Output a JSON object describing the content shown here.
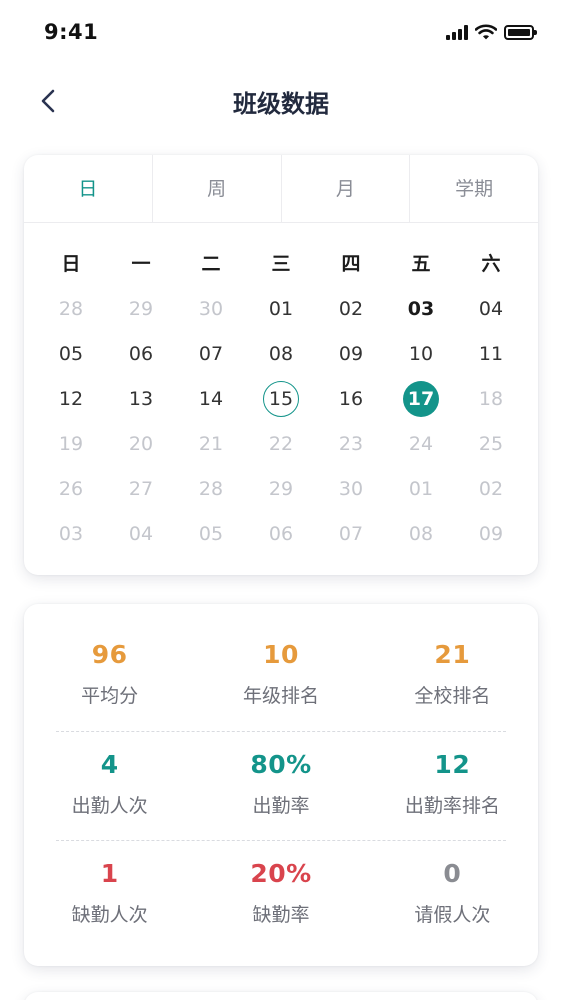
{
  "status_bar": {
    "time": "9:41"
  },
  "header": {
    "title": "班级数据"
  },
  "tabs": [
    {
      "label": "日",
      "active": true
    },
    {
      "label": "周",
      "active": false
    },
    {
      "label": "月",
      "active": false
    },
    {
      "label": "学期",
      "active": false
    }
  ],
  "calendar": {
    "weekdays": [
      "日",
      "一",
      "二",
      "三",
      "四",
      "五",
      "六"
    ],
    "weeks": [
      [
        "28",
        "29",
        "30",
        "01",
        "02",
        "03",
        "04"
      ],
      [
        "05",
        "06",
        "07",
        "08",
        "09",
        "10",
        "11"
      ],
      [
        "12",
        "13",
        "14",
        "15",
        "16",
        "17",
        "18"
      ],
      [
        "19",
        "20",
        "21",
        "22",
        "23",
        "24",
        "25"
      ],
      [
        "26",
        "27",
        "28",
        "29",
        "30",
        "01",
        "02"
      ],
      [
        "03",
        "04",
        "05",
        "06",
        "07",
        "08",
        "09"
      ]
    ],
    "today": "15",
    "selected": "17"
  },
  "stats": {
    "row1": [
      {
        "value": "96",
        "label": "平均分"
      },
      {
        "value": "10",
        "label": "年级排名"
      },
      {
        "value": "21",
        "label": "全校排名"
      }
    ],
    "row2": [
      {
        "value": "4",
        "label": "出勤人次"
      },
      {
        "value": "80%",
        "label": "出勤率"
      },
      {
        "value": "12",
        "label": "出勤率排名"
      }
    ],
    "row3": [
      {
        "value": "1",
        "label": "缺勤人次"
      },
      {
        "value": "20%",
        "label": "缺勤率"
      },
      {
        "value": "0",
        "label": "请假人次"
      }
    ]
  },
  "colors": {
    "accent": "#13948a",
    "score": "#e69a3c",
    "absence": "#d9444d",
    "neutral": "#8a8c92"
  },
  "icons": {
    "back": "chevron-left-icon",
    "signal": "signal-icon",
    "wifi": "wifi-icon",
    "battery": "battery-icon"
  }
}
